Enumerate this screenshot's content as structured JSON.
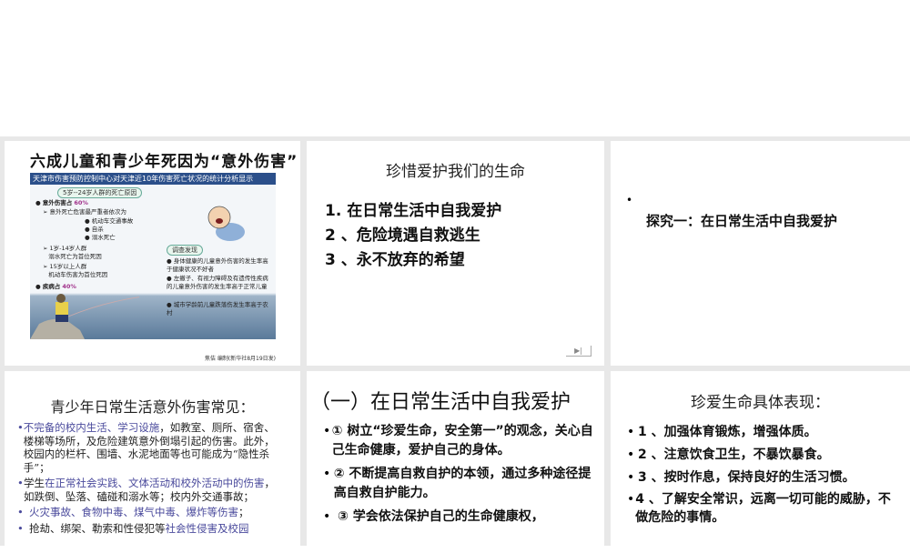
{
  "slides": [
    {
      "title": "六成儿童和青少年死因为“意外伤害”",
      "subtitle": "天津市伤害预防控制中心对天津近10年伤害死亡状况的统计分析显示",
      "cause_tag": "5岁--24岁人群的死亡原因",
      "accident_label": "意外伤害占",
      "accident_pct": "60%",
      "accident_order": "意外死亡危害最严重者依次为",
      "accident_items": [
        "机动车交通事故",
        "自杀",
        "溺水死亡"
      ],
      "age_group_1": "1岁-14岁人群",
      "age_group_1_cause": "溺水死亡为首位死因",
      "age_group_2": "15岁以上人群",
      "age_group_2_cause": "机动车伤害为首位死因",
      "disease_label": "疾病占",
      "disease_pct": "40%",
      "survey_tag": "调查发现",
      "survey_items": [
        "身体健康的儿童意外伤害的发生率高于健康状况不好者",
        "左撇子、有视力障碍及有遗传性疾病的儿童意外伤害的发生率高于正常儿童",
        "城市学龄前儿童跌落伤发生率高于农村"
      ],
      "credit": "焦佶 编制(新华社8月19日发)"
    },
    {
      "title": "珍惜爱护我们的生命",
      "items": [
        "1. 在日常生活中自我爱护",
        "2 、危险境遇自救逃生",
        "3 、永不放弃的希望"
      ],
      "nav_icon": "play-end-icon"
    },
    {
      "bullet": "•",
      "text": "探究一：在日常生活中自我爱护"
    },
    {
      "title": "青少年日常生活意外伤害常见：",
      "bullets": [
        {
          "highlight": "不完备的校内生活、学习设施",
          "rest": "，如教室、厕所、宿舍、楼梯等场所，及危险建筑意外倒塌引起的伤害。此外，校园内的栏杆、围墙、水泥地面等也可能成为“隐性杀手”；"
        },
        {
          "pre": "学生",
          "highlight": "在正常社会实践、文体活动和校外活动中的伤害",
          "rest": "，如跌倒、坠落、磕碰和溺水等；校内外交通事故；"
        },
        {
          "highlight": "火灾事故、食物中毒、煤气中毒、爆炸等伤害",
          "rest": "；"
        },
        {
          "pre": "抢劫、绑架、勒索和性侵犯等",
          "highlight": "社会性侵害及校园",
          "rest": ""
        }
      ],
      "highlight_color": "#4a4a9c"
    },
    {
      "title": "（一）在日常生活中自我爱护",
      "bullets": [
        "① 树立“珍爱生命，安全第一”的观念，关心自己生命健康，爱护自己的身体。",
        "② 不断提高自救自护的本领，通过多种途径提高自救自护能力。",
        "③ 学会依法保护自己的生命健康权，"
      ]
    },
    {
      "title": "珍爱生命具体表现：",
      "bullets": [
        "1 、加强体育锻炼，增强体质。",
        "2 、注意饮食卫生，不暴饮暴食。",
        "3 、按时作息，保持良好的生活习惯。",
        "4 、了解安全常识，远离一切可能的威胁，不做危险的事情。"
      ]
    }
  ]
}
